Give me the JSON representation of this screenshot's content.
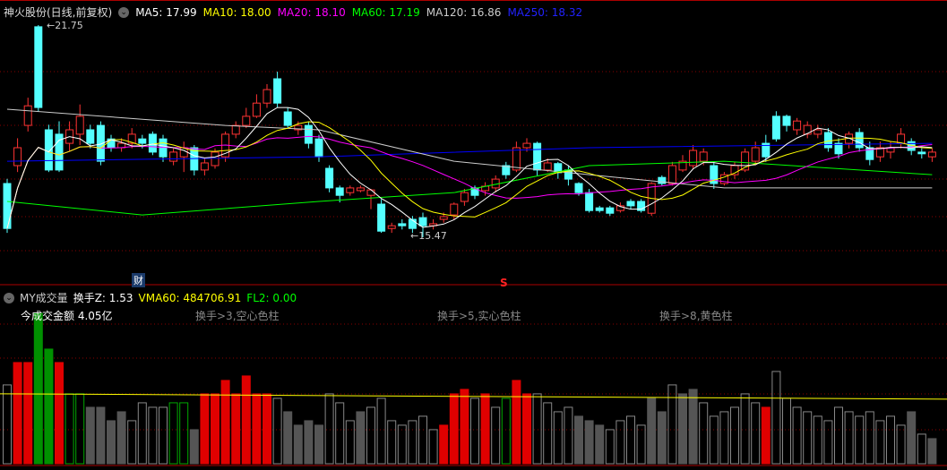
{
  "header": {
    "title": "神火股份(日线,前复权)",
    "ma5": "MA5: 17.99",
    "ma10": "MA10: 18.00",
    "ma20": "MA20: 18.10",
    "ma60": "MA60: 17.19",
    "ma120": "MA120: 16.86",
    "ma250": "MA250: 18.32"
  },
  "price_labels": {
    "high": "21.75",
    "low": "15.47"
  },
  "markers": {
    "cai": "财",
    "s": "S"
  },
  "volume_header": {
    "name": "MY成交量",
    "turnover": "换手Z: 1.53",
    "vma60": "VMA60: 484706.91",
    "fl2": "FL2: 0.00"
  },
  "volume_notes": {
    "amount": "今成交金额 4.05亿",
    "n1": "换手>3,空心色柱",
    "n2": "换手>5,实心色柱",
    "n3": "换手>8,黄色柱"
  },
  "colors": {
    "up": "#ff3333",
    "down": "#54ffff",
    "ma5": "#ffffff",
    "ma10": "#ffff00",
    "ma20": "#ff00ff",
    "ma60": "#00ff00",
    "ma120": "#cccccc",
    "ma250": "#0000ff"
  },
  "chart_data": {
    "type": "candlestick",
    "candles": [
      [
        17.06,
        15.73,
        17.2,
        15.6
      ],
      [
        17.59,
        18.12,
        18.4,
        17.4
      ],
      [
        18.78,
        19.36,
        19.6,
        18.6
      ],
      [
        21.7,
        19.31,
        21.75,
        19.2
      ],
      [
        18.65,
        17.46,
        18.8,
        17.4
      ],
      [
        18.52,
        17.46,
        18.9,
        17.4
      ],
      [
        18.25,
        18.65,
        18.9,
        18.0
      ],
      [
        18.52,
        19.05,
        19.4,
        18.2
      ],
      [
        18.65,
        18.25,
        18.8,
        18.1
      ],
      [
        18.78,
        17.72,
        18.9,
        17.6
      ],
      [
        18.38,
        18.12,
        18.5,
        18.0
      ],
      [
        18.12,
        18.25,
        18.4,
        18.0
      ],
      [
        18.25,
        18.52,
        18.7,
        18.1
      ],
      [
        18.38,
        18.25,
        18.5,
        18.1
      ],
      [
        18.52,
        17.99,
        18.6,
        17.9
      ],
      [
        18.38,
        17.85,
        18.5,
        17.7
      ],
      [
        17.72,
        17.99,
        18.1,
        17.6
      ],
      [
        17.85,
        18.12,
        18.3,
        17.4
      ],
      [
        18.12,
        17.46,
        18.2,
        17.3
      ],
      [
        17.46,
        17.67,
        17.8,
        17.3
      ],
      [
        17.59,
        17.99,
        18.1,
        17.5
      ],
      [
        17.85,
        18.52,
        18.6,
        17.7
      ],
      [
        18.52,
        18.78,
        18.9,
        18.4
      ],
      [
        18.78,
        19.05,
        19.3,
        18.7
      ],
      [
        19.05,
        19.44,
        19.7,
        19.0
      ],
      [
        19.44,
        19.84,
        20.0,
        19.3
      ],
      [
        20.16,
        19.44,
        20.37,
        19.3
      ],
      [
        19.18,
        18.78,
        19.3,
        18.7
      ],
      [
        18.65,
        18.78,
        18.9,
        18.5
      ],
      [
        18.78,
        18.25,
        18.9,
        18.1
      ],
      [
        18.38,
        17.85,
        18.5,
        17.7
      ],
      [
        17.51,
        16.93,
        17.6,
        16.8
      ],
      [
        16.93,
        16.71,
        17.0,
        16.5
      ],
      [
        16.79,
        16.93,
        17.0,
        16.7
      ],
      [
        16.85,
        16.93,
        17.0,
        16.8
      ],
      [
        16.71,
        16.87,
        16.9,
        16.3
      ],
      [
        16.45,
        15.65,
        16.6,
        15.6
      ],
      [
        15.73,
        15.81,
        15.9,
        15.6
      ],
      [
        15.87,
        15.81,
        16.0,
        15.7
      ],
      [
        16.0,
        15.73,
        16.1,
        15.6
      ],
      [
        16.05,
        15.81,
        16.2,
        15.47
      ],
      [
        15.81,
        15.87,
        16.0,
        15.7
      ],
      [
        16.0,
        16.08,
        16.2,
        15.9
      ],
      [
        16.13,
        16.45,
        16.5,
        16.0
      ],
      [
        16.53,
        16.79,
        16.9,
        16.4
      ],
      [
        16.93,
        16.71,
        17.0,
        16.6
      ],
      [
        16.85,
        16.98,
        17.1,
        16.7
      ],
      [
        16.93,
        17.19,
        17.3,
        16.8
      ],
      [
        17.59,
        17.32,
        17.7,
        17.2
      ],
      [
        17.46,
        18.12,
        18.3,
        17.4
      ],
      [
        18.12,
        18.25,
        18.4,
        18.0
      ],
      [
        18.25,
        17.46,
        18.3,
        17.3
      ],
      [
        17.46,
        17.67,
        17.8,
        17.4
      ],
      [
        17.65,
        17.38,
        17.7,
        17.2
      ],
      [
        17.46,
        17.19,
        17.6,
        17.0
      ],
      [
        17.06,
        16.79,
        17.1,
        16.7
      ],
      [
        16.79,
        16.26,
        16.9,
        16.2
      ],
      [
        16.34,
        16.26,
        16.4,
        16.2
      ],
      [
        16.34,
        16.18,
        16.4,
        16.1
      ],
      [
        16.26,
        16.4,
        16.5,
        16.2
      ],
      [
        16.53,
        16.4,
        16.6,
        16.3
      ],
      [
        16.53,
        16.26,
        16.6,
        16.2
      ],
      [
        16.18,
        17.06,
        17.1,
        16.1
      ],
      [
        17.24,
        17.06,
        17.3,
        17.0
      ],
      [
        17.06,
        17.59,
        17.7,
        17.0
      ],
      [
        17.46,
        17.72,
        17.9,
        17.4
      ],
      [
        17.59,
        18.04,
        18.2,
        17.5
      ],
      [
        17.72,
        17.99,
        18.1,
        17.6
      ],
      [
        17.59,
        17.06,
        17.7,
        16.9
      ],
      [
        17.06,
        17.32,
        17.4,
        17.0
      ],
      [
        17.32,
        17.59,
        17.7,
        17.2
      ],
      [
        17.46,
        17.99,
        18.1,
        17.4
      ],
      [
        17.72,
        18.12,
        18.3,
        17.6
      ],
      [
        18.25,
        17.85,
        18.5,
        17.7
      ],
      [
        19.05,
        18.38,
        19.2,
        18.3
      ],
      [
        19.05,
        18.78,
        19.1,
        18.6
      ],
      [
        18.65,
        18.91,
        19.0,
        18.5
      ],
      [
        18.52,
        18.78,
        18.9,
        18.4
      ],
      [
        18.52,
        18.65,
        18.8,
        18.4
      ],
      [
        18.57,
        18.12,
        18.7,
        18.0
      ],
      [
        18.25,
        17.94,
        18.4,
        17.8
      ],
      [
        18.25,
        18.52,
        18.6,
        18.1
      ],
      [
        18.57,
        18.12,
        18.7,
        18.0
      ],
      [
        18.12,
        17.77,
        18.3,
        17.6
      ],
      [
        17.85,
        18.12,
        18.3,
        17.7
      ],
      [
        17.99,
        18.12,
        18.3,
        17.8
      ],
      [
        18.25,
        18.52,
        18.7,
        18.1
      ],
      [
        18.3,
        18.04,
        18.4,
        17.9
      ],
      [
        17.99,
        17.94,
        18.1,
        17.8
      ],
      [
        17.85,
        17.99,
        18.1,
        17.7
      ]
    ],
    "ma60_points": [
      [
        0,
        16.53
      ],
      [
        13,
        16.13
      ],
      [
        30,
        16.53
      ],
      [
        43,
        16.79
      ],
      [
        56,
        17.59
      ],
      [
        69,
        17.72
      ],
      [
        89,
        17.32
      ]
    ],
    "ma120_points": [
      [
        0,
        19.26
      ],
      [
        21,
        18.78
      ],
      [
        30,
        18.65
      ],
      [
        43,
        17.72
      ],
      [
        56,
        17.32
      ],
      [
        69,
        16.93
      ],
      [
        89,
        16.93
      ]
    ],
    "ma250_points": [
      [
        0,
        17.72
      ],
      [
        30,
        17.85
      ],
      [
        56,
        18.12
      ],
      [
        89,
        18.25
      ]
    ],
    "price_range": [
      15.2,
      22.1
    ],
    "volumes_wan": [
      54.6,
      70.1,
      70.1,
      104.2,
      79.4,
      70.1,
      48.4,
      48.4,
      39.1,
      39.1,
      29.8,
      36.0,
      29.8,
      42.2,
      39.1,
      39.1,
      42.2,
      42.2,
      23.6,
      48.4,
      48.4,
      57.7,
      48.4,
      60.8,
      48.4,
      48.4,
      45.3,
      36.0,
      26.7,
      29.8,
      26.7,
      48.4,
      42.2,
      29.8,
      36.0,
      39.1,
      45.3,
      29.8,
      26.7,
      29.8,
      32.9,
      23.6,
      26.7,
      48.4,
      51.5,
      45.3,
      48.4,
      39.1,
      45.3,
      57.7,
      48.4,
      48.4,
      42.2,
      36.0,
      39.1,
      32.9,
      29.8,
      26.7,
      23.6,
      29.8,
      32.9,
      26.7,
      45.3,
      36.0,
      54.6,
      48.4,
      51.5,
      42.2,
      32.9,
      36.0,
      39.1,
      48.4,
      42.2,
      39.1,
      63.9,
      45.3,
      39.1,
      36.0,
      32.9,
      29.8,
      39.1,
      36.0,
      32.9,
      36.0,
      29.8,
      32.9,
      26.7,
      36.0,
      20.5,
      17.4
    ],
    "volume_styles": "hrrggrHHsssshhhhHHsrrrrrrrhsssshhhshhhhhhhrrrhrhHrrhhhhssshhhhsshsshhhhhhRhhhhhhhhhhhhhshss",
    "vma60_wan": 48.47
  }
}
